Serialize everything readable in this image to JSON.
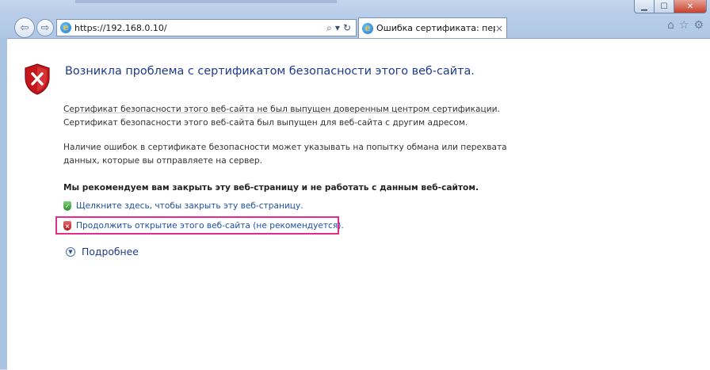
{
  "browser": {
    "address_url": "https://192.168.0.10/",
    "tab_title": "Ошибка сертификата: пер...",
    "tab_close": "×",
    "window_controls": {
      "minimize": "▁",
      "maximize": "☐",
      "close": "✕"
    },
    "toolbar_icons": [
      "home-icon",
      "star-icon",
      "gear-icon"
    ],
    "address_tools": [
      "search-icon",
      "dropdown-icon",
      "refresh-icon"
    ]
  },
  "page": {
    "heading": "Возникла проблема с сертификатом безопасности этого веб-сайта.",
    "paragraph1_line1": "Сертификат безопасности этого веб-сайта не был выпущен доверенным центром сертификации.",
    "paragraph1_line2": "Сертификат безопасности этого веб-сайта был выпущен для веб-сайта с другим адресом.",
    "paragraph2_line1": "Наличие ошибок в сертификате безопасности может указывать на попытку обмана или перехвата",
    "paragraph2_line2": "данных, которые вы отправляете на сервер.",
    "recommendation": "Мы рекомендуем вам закрыть эту веб-страницу и не работать с данным веб-сайтом.",
    "close_link": "Щелкните здесь, чтобы закрыть эту веб-страницу.",
    "continue_link": "Продолжить открытие этого веб-сайта (не рекомендуется).",
    "more_info": "Подробнее"
  },
  "colors": {
    "link": "#1f4fa8",
    "heading": "#1f3a8a",
    "highlight_border": "#e62b8f",
    "error_red": "#c4161c"
  }
}
